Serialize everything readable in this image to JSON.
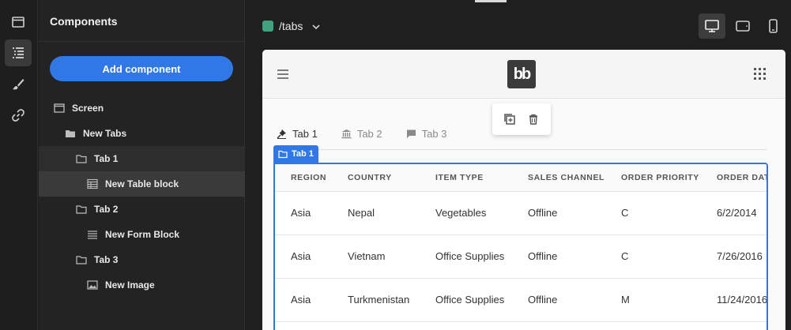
{
  "sidebar": {
    "title": "Components",
    "add_button": "Add component",
    "tree": [
      {
        "label": "Screen",
        "icon": "screen-icon"
      },
      {
        "label": "New Tabs",
        "icon": "folder-filled-icon"
      },
      {
        "label": "Tab 1",
        "icon": "folder-icon"
      },
      {
        "label": "New Table block",
        "icon": "table-icon"
      },
      {
        "label": "Tab 2",
        "icon": "folder-icon"
      },
      {
        "label": "New Form Block",
        "icon": "form-icon"
      },
      {
        "label": "Tab 3",
        "icon": "folder-icon"
      },
      {
        "label": "New Image",
        "icon": "image-icon"
      }
    ]
  },
  "topbar": {
    "route": "/tabs",
    "route_color": "#3fa37f"
  },
  "preview": {
    "logo": "bb",
    "tabs": [
      {
        "label": "Tab 1",
        "icon": "pin-icon"
      },
      {
        "label": "Tab 2",
        "icon": "bank-icon"
      },
      {
        "label": "Tab 3",
        "icon": "chat-icon"
      }
    ],
    "selection_label": "Tab 1",
    "table": {
      "columns": [
        "REGION",
        "COUNTRY",
        "ITEM TYPE",
        "SALES CHANNEL",
        "ORDER PRIORITY",
        "ORDER DATE"
      ],
      "rows": [
        [
          "Asia",
          "Nepal",
          "Vegetables",
          "Offline",
          "C",
          "6/2/2014"
        ],
        [
          "Asia",
          "Vietnam",
          "Office Supplies",
          "Offline",
          "C",
          "7/26/2016"
        ],
        [
          "Asia",
          "Turkmenistan",
          "Office Supplies",
          "Offline",
          "M",
          "11/24/2016"
        ]
      ]
    }
  },
  "colors": {
    "accent": "#2f78e6",
    "selected_bg": "#3a3a3a"
  }
}
